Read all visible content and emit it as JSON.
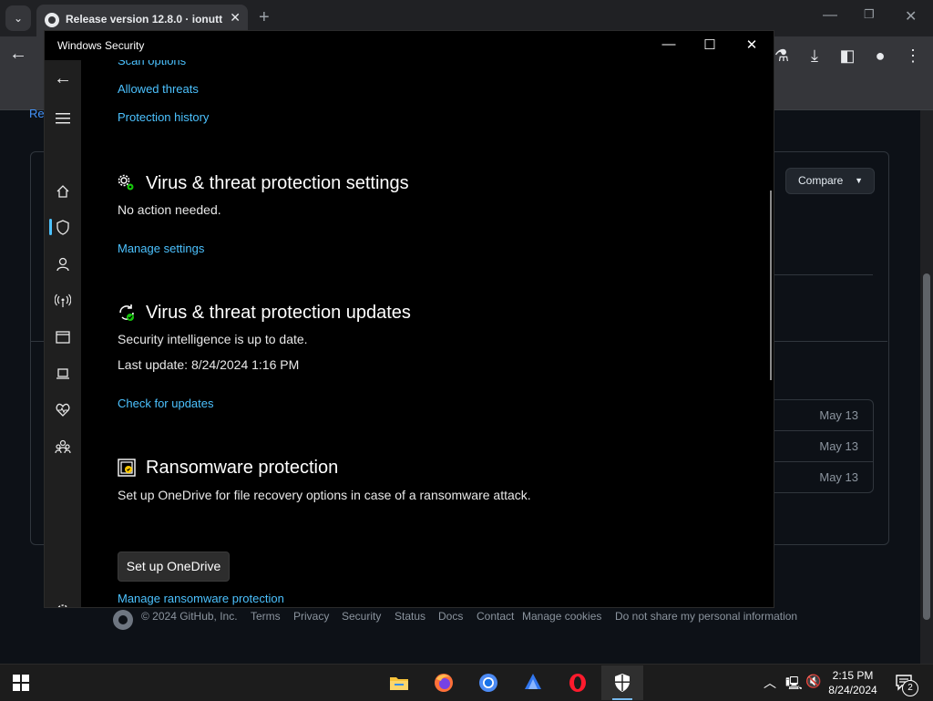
{
  "browser": {
    "tab": {
      "title": "Release version 12.8.0 · ionutt..."
    },
    "page": {
      "partial_link": "Re",
      "compare_button": "Compare",
      "release_dates": [
        "May 13",
        "May 13",
        "May 13"
      ],
      "footer": {
        "copyright": "© 2024 GitHub, Inc.",
        "links": [
          "Terms",
          "Privacy",
          "Security",
          "Status",
          "Docs",
          "Contact",
          "Manage cookies",
          "Do not share my personal information"
        ]
      }
    }
  },
  "windows_security": {
    "title": "Windows Security",
    "top_links": [
      "Scan options",
      "Allowed threats",
      "Protection history"
    ],
    "settings_section": {
      "heading": "Virus & threat protection settings",
      "status": "No action needed.",
      "link": "Manage settings"
    },
    "updates_section": {
      "heading": "Virus & threat protection updates",
      "status": "Security intelligence is up to date.",
      "last_update": "Last update: 8/24/2024 1:16 PM",
      "link": "Check for updates"
    },
    "ransomware_section": {
      "heading": "Ransomware protection",
      "description": "Set up OneDrive for file recovery options in case of a ransomware attack.",
      "button": "Set up OneDrive",
      "link": "Manage ransomware protection"
    },
    "nav_icons": [
      "back-arrow",
      "hamburger-menu",
      "home",
      "shield",
      "person",
      "wireless",
      "app-browser",
      "laptop",
      "heart-pulse",
      "family",
      "gear"
    ]
  },
  "taskbar": {
    "time": "2:15 PM",
    "date": "8/24/2024",
    "notification_count": "2",
    "apps": [
      "file-explorer",
      "firefox",
      "chrome",
      "edge-beta",
      "opera",
      "windows-security"
    ]
  }
}
